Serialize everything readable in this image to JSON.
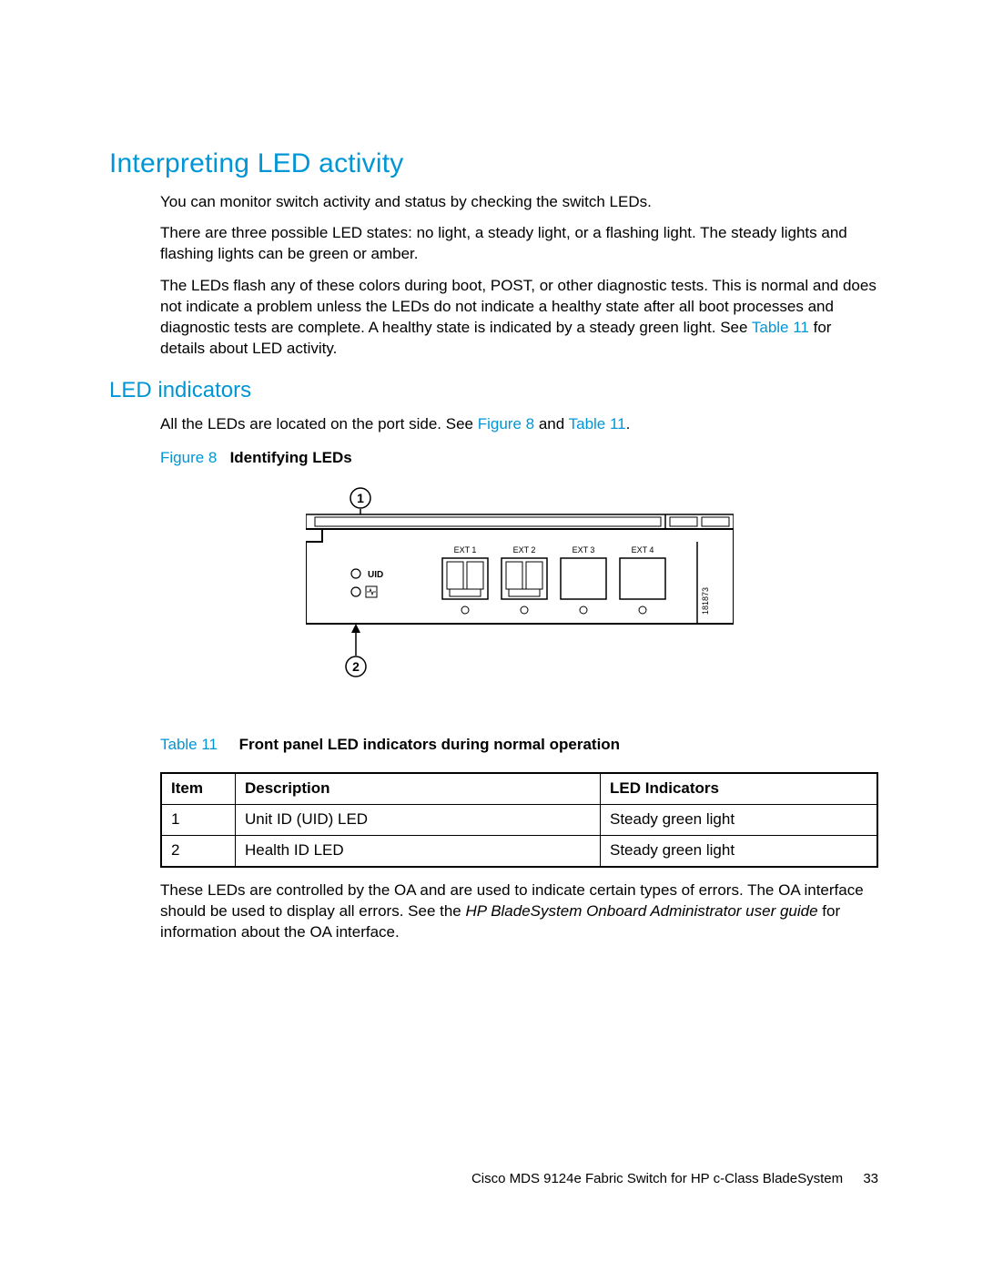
{
  "headings": {
    "h1": "Interpreting LED activity",
    "h2": "LED indicators"
  },
  "paragraphs": {
    "p1": "You can monitor switch activity and status by checking the switch LEDs.",
    "p2": "There are three possible LED states: no light, a steady light, or a flashing light. The steady lights and flashing lights can be green or amber.",
    "p3a": "The LEDs flash any of these colors during boot, POST, or other diagnostic tests. This is normal and does not indicate a problem unless the LEDs do not indicate a healthy state after all boot processes and diagnostic tests are complete. A healthy state is indicated by a steady green light. See ",
    "p3_link": "Table 11",
    "p3b": " for details about LED activity.",
    "p4a": "All the LEDs are located on the port side. See ",
    "p4_link1": "Figure 8",
    "p4_mid": " and ",
    "p4_link2": "Table 11",
    "p4b": ".",
    "p5a": "These LEDs are controlled by the OA and are used to indicate certain types of errors. The OA interface should be used to display all errors. See the ",
    "p5_em": "HP BladeSystem Onboard Administrator user guide",
    "p5b": " for information about the OA interface."
  },
  "figure": {
    "label": "Figure 8",
    "title": "Identifying LEDs",
    "callouts": {
      "c1": "1",
      "c2": "2"
    },
    "labels": {
      "uid": "UID",
      "ext1": "EXT 1",
      "ext2": "EXT 2",
      "ext3": "EXT 3",
      "ext4": "EXT 4",
      "partno": "181873"
    }
  },
  "table": {
    "label": "Table 11",
    "title": "Front panel LED indicators during normal operation",
    "headers": {
      "item": "Item",
      "desc": "Description",
      "ind": "LED Indicators"
    },
    "rows": [
      {
        "item": "1",
        "desc": "Unit ID (UID) LED",
        "ind": "Steady green light"
      },
      {
        "item": "2",
        "desc": "Health ID LED",
        "ind": "Steady green light"
      }
    ]
  },
  "footer": {
    "title": "Cisco MDS 9124e Fabric Switch for HP c-Class BladeSystem",
    "page": "33"
  }
}
